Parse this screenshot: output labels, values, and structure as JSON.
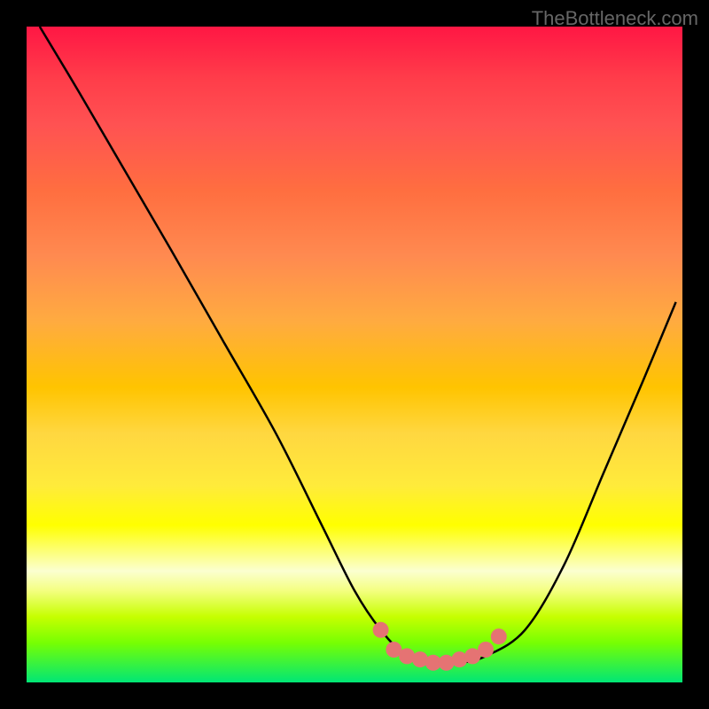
{
  "watermark": "TheBottleneck.com",
  "chart_data": {
    "type": "line",
    "title": "",
    "xlabel": "",
    "ylabel": "",
    "xlim": [
      0,
      100
    ],
    "ylim": [
      0,
      100
    ],
    "series": [
      {
        "name": "bottleneck-curve",
        "x": [
          2,
          8,
          15,
          22,
          30,
          38,
          45,
          50,
          54,
          58,
          62,
          66,
          70,
          76,
          82,
          88,
          94,
          99
        ],
        "y": [
          100,
          90,
          78,
          66,
          52,
          38,
          24,
          14,
          8,
          4,
          3,
          3,
          4,
          8,
          18,
          32,
          46,
          58
        ]
      }
    ],
    "highlight_dots": {
      "name": "optimal-range-markers",
      "color": "#e57373",
      "points": [
        {
          "x": 54,
          "y": 8
        },
        {
          "x": 56,
          "y": 5
        },
        {
          "x": 58,
          "y": 4
        },
        {
          "x": 60,
          "y": 3.5
        },
        {
          "x": 62,
          "y": 3
        },
        {
          "x": 64,
          "y": 3
        },
        {
          "x": 66,
          "y": 3.5
        },
        {
          "x": 68,
          "y": 4
        },
        {
          "x": 70,
          "y": 5
        },
        {
          "x": 72,
          "y": 7
        }
      ]
    },
    "colors": {
      "gradient_top": "#ff1744",
      "gradient_mid": "#ffeb3b",
      "gradient_bottom": "#00e676",
      "curve": "#000000",
      "dots": "#e57373",
      "frame": "#000000"
    }
  }
}
